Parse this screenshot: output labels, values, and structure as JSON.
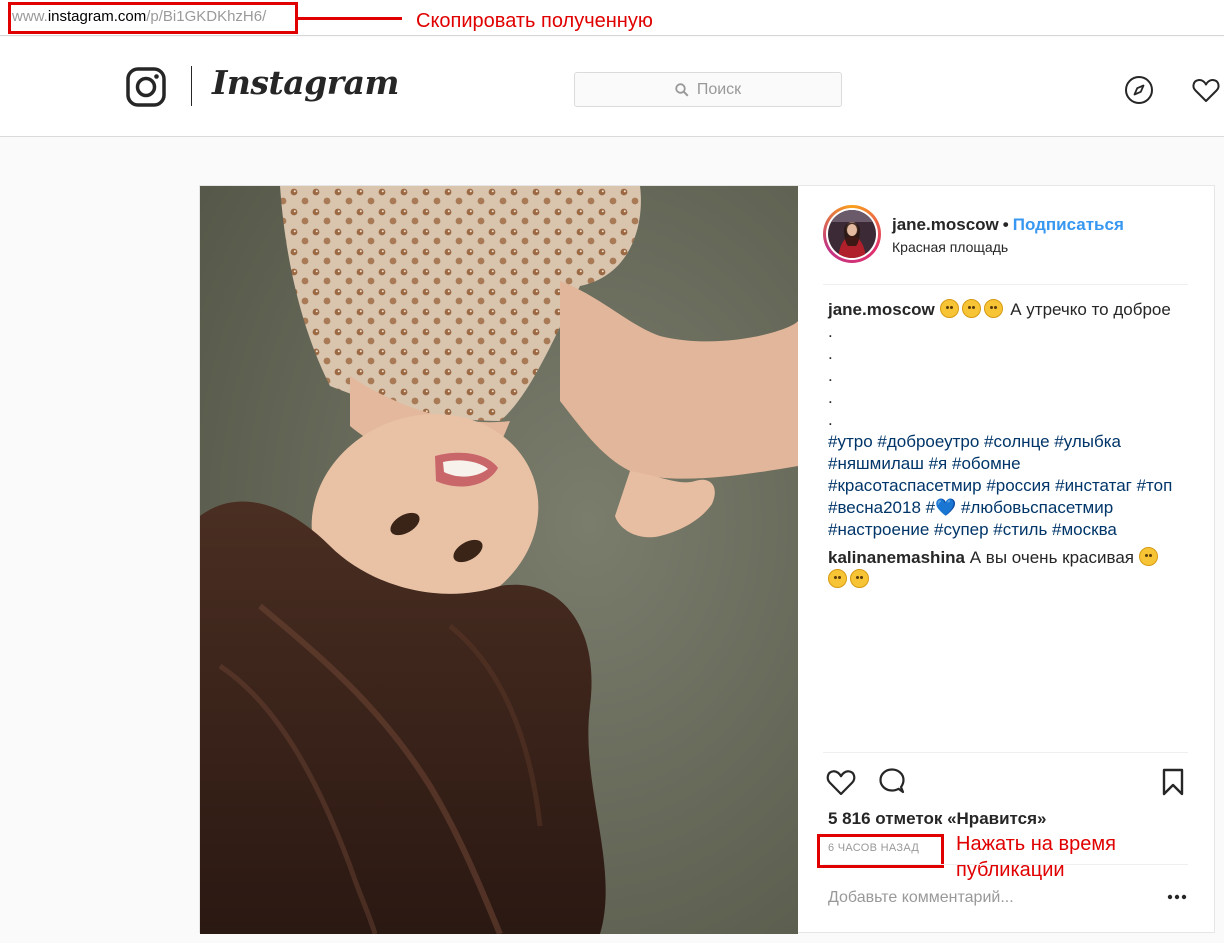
{
  "address_bar": {
    "prefix": "www.",
    "host": "instagram.com",
    "path": "/p/Bi1GKDKhzH6/",
    "note": "Скопировать полученную ссылку"
  },
  "header": {
    "logo_text": "Instagram",
    "search_placeholder": "Поиск"
  },
  "post": {
    "author": "jane.moscow",
    "separator": "•",
    "follow_label": "Подписаться",
    "location": "Красная площадь",
    "caption": {
      "username": "jane.moscow",
      "text": "А утречко то доброе",
      "dots": [
        ".",
        ".",
        ".",
        ".",
        "."
      ],
      "hashtags": [
        "#утро #доброеутро #солнце #улыбка",
        "#няшмилаш #я #обомне",
        "#красотаспасетмир #россия #инстатаг #топ",
        "#весна2018 #💙 #любовьспасетмир",
        "#настроение #супер #стиль #москва"
      ]
    },
    "comment": {
      "username": "kalinanemashina",
      "text": "А вы очень красивая"
    },
    "likes": "5 816 отметок «Нравится»",
    "time": "6 ЧАСОВ НАЗАД",
    "time_note": "Нажать на время публикации",
    "add_comment_placeholder": "Добавьте комментарий..."
  },
  "icons": {
    "logo": "instagram-glyph-icon",
    "search": "search-icon",
    "explore": "compass-icon",
    "activity": "heart-icon",
    "like": "heart-outline-icon",
    "comment": "comment-bubble-icon",
    "save": "bookmark-icon",
    "more": "more-dots-icon"
  },
  "colors": {
    "annotation_red": "#e00000",
    "link_blue": "#3897f0",
    "hashtag_blue": "#003569",
    "muted_gray": "#999999"
  }
}
